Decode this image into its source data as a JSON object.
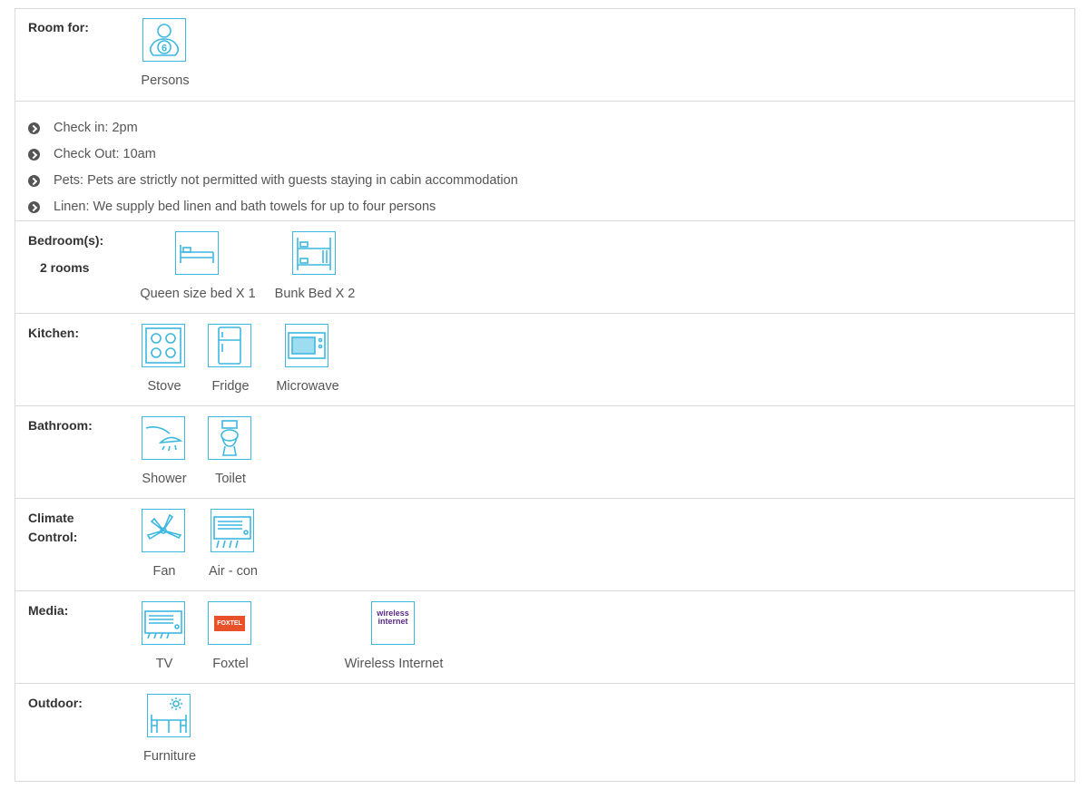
{
  "room_for": {
    "label": "Room for:",
    "icon": "person-6-icon",
    "badge": "6",
    "caption": "Persons"
  },
  "info": [
    "Check in: 2pm",
    "Check Out: 10am",
    "Pets: Pets are strictly not permitted with guests staying in cabin accommodation",
    "Linen: We supply bed linen and bath towels for up to four persons"
  ],
  "bedrooms": {
    "label": "Bedroom(s):",
    "count": "2 rooms",
    "items": [
      {
        "icon": "queen-bed-icon",
        "caption": "Queen size bed X 1"
      },
      {
        "icon": "bunk-bed-icon",
        "caption": "Bunk Bed X 2"
      }
    ]
  },
  "kitchen": {
    "label": "Kitchen:",
    "items": [
      {
        "icon": "stove-icon",
        "caption": "Stove"
      },
      {
        "icon": "fridge-icon",
        "caption": "Fridge"
      },
      {
        "icon": "microwave-icon",
        "caption": "Microwave"
      }
    ]
  },
  "bathroom": {
    "label": "Bathroom:",
    "items": [
      {
        "icon": "shower-icon",
        "caption": "Shower"
      },
      {
        "icon": "toilet-icon",
        "caption": "Toilet"
      }
    ]
  },
  "climate": {
    "label_line1": "Climate",
    "label_line2": "Control:",
    "items": [
      {
        "icon": "fan-icon",
        "caption": "Fan"
      },
      {
        "icon": "air-con-icon",
        "caption": "Air - con"
      }
    ]
  },
  "media": {
    "label": "Media:",
    "items": [
      {
        "icon": "tv-icon",
        "caption": "TV"
      },
      {
        "icon": "foxtel-logo-icon",
        "caption": "Foxtel",
        "logo_text": "FOXTEL"
      },
      {
        "icon": "wireless-internet-icon",
        "caption": "Wireless Internet",
        "logo_line1": "wireless",
        "logo_line2": "internet"
      }
    ]
  },
  "outdoor": {
    "label": "Outdoor:",
    "items": [
      {
        "icon": "outdoor-furniture-icon",
        "caption": "Furniture"
      }
    ]
  },
  "colors": {
    "icon_stroke": "#3cb8e0",
    "border": "#d9d9d9",
    "foxtel": "#e8512a",
    "wifi": "#5a2a86"
  }
}
